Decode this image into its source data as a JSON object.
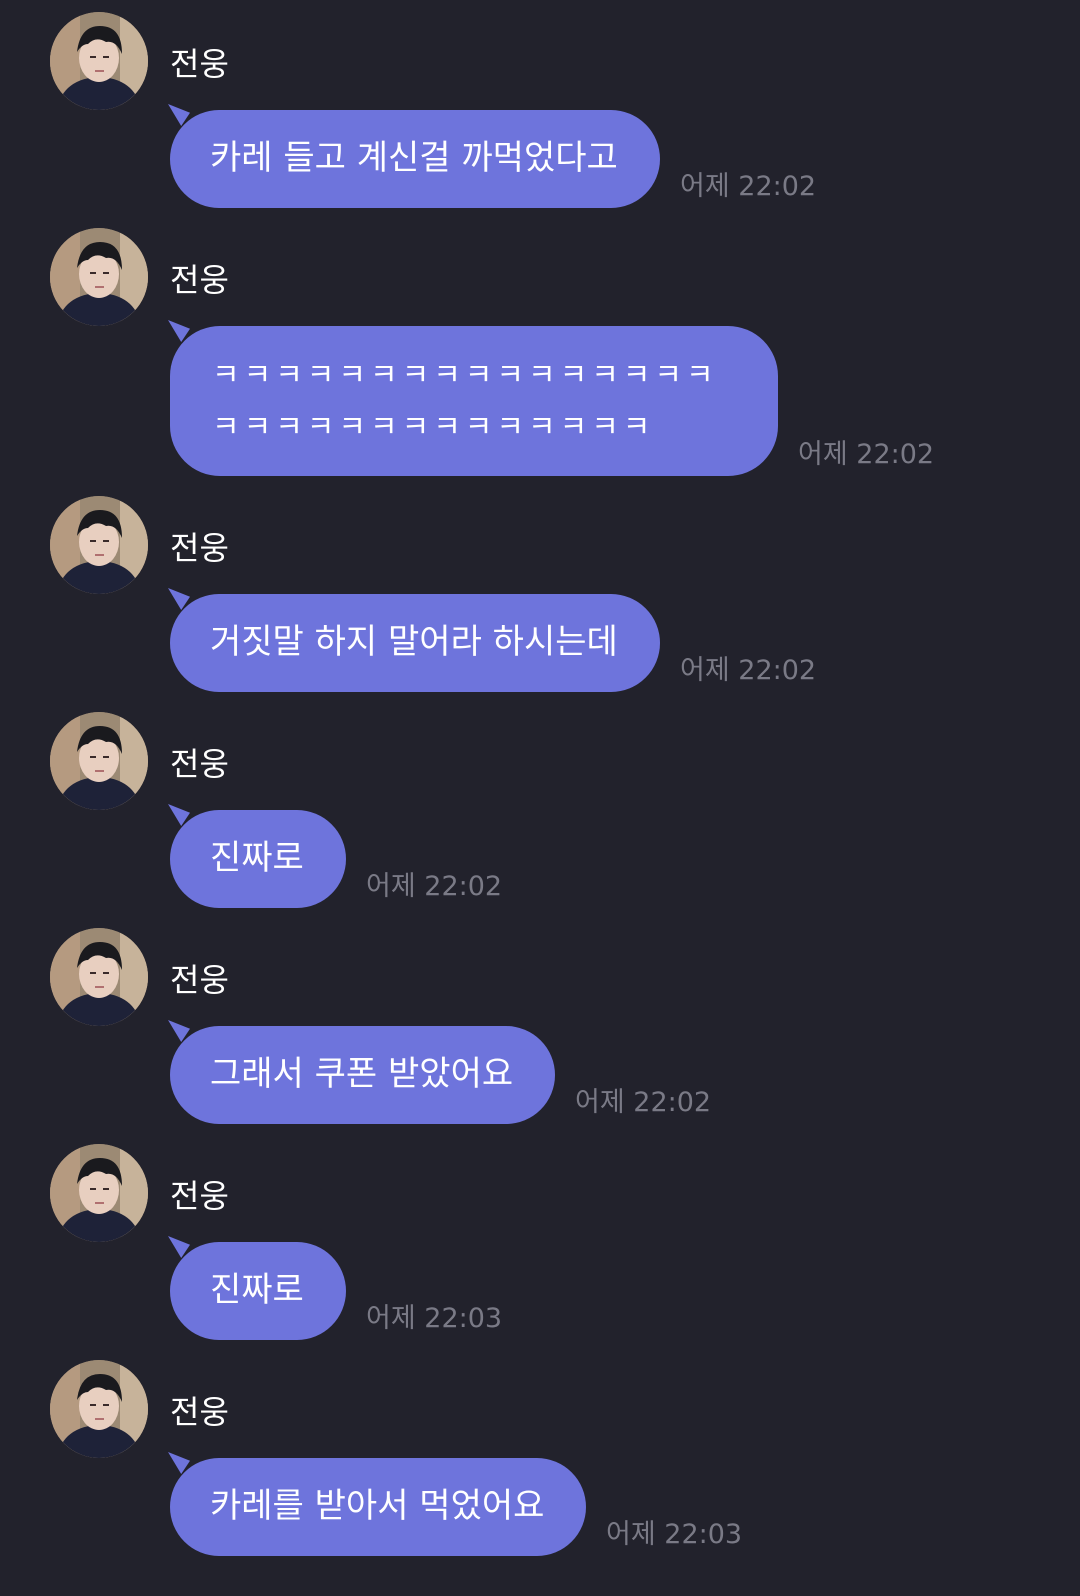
{
  "colors": {
    "background": "#22222c",
    "bubble": "#6e74dc",
    "name_text": "#ffffff",
    "time_text": "#7a7a86"
  },
  "messages": [
    {
      "sender": "전웅",
      "lines": [
        "카레 들고 계신걸 까먹었다고"
      ],
      "time": "어제 22:02"
    },
    {
      "sender": "전웅",
      "lines": [
        "ㅋㅋㅋㅋㅋㅋㅋㅋㅋㅋㅋㅋㅋㅋㅋㅋ",
        "ㅋㅋㅋㅋㅋㅋㅋㅋㅋㅋㅋㅋㅋㅋ"
      ],
      "time": "어제 22:02"
    },
    {
      "sender": "전웅",
      "lines": [
        "거짓말 하지 말어라 하시는데"
      ],
      "time": "어제 22:02"
    },
    {
      "sender": "전웅",
      "lines": [
        "진짜로"
      ],
      "time": "어제 22:02"
    },
    {
      "sender": "전웅",
      "lines": [
        "그래서 쿠폰 받았어요"
      ],
      "time": "어제 22:02"
    },
    {
      "sender": "전웅",
      "lines": [
        "진짜로"
      ],
      "time": "어제 22:03"
    },
    {
      "sender": "전웅",
      "lines": [
        "카레를 받아서 먹었어요"
      ],
      "time": "어제 22:03"
    }
  ]
}
